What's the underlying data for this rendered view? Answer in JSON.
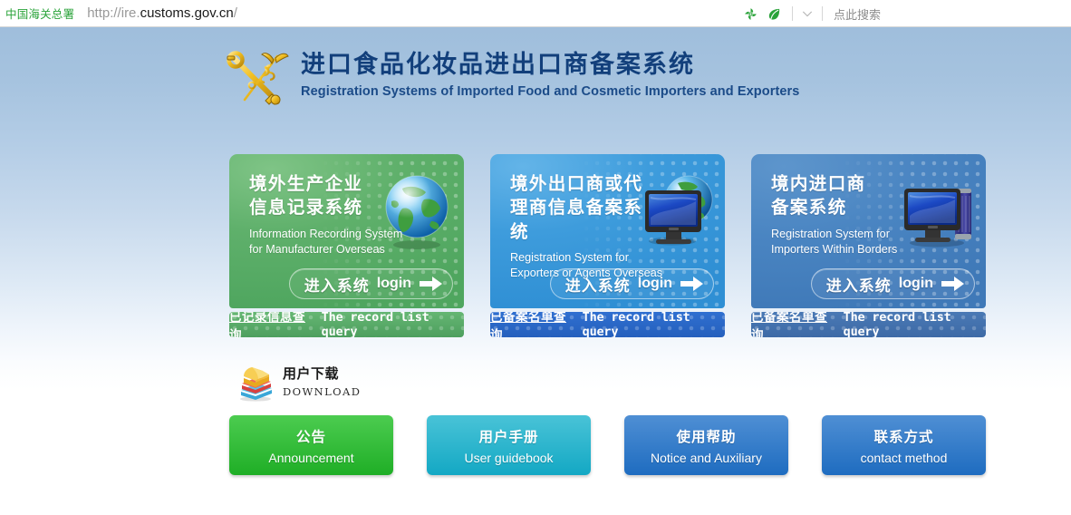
{
  "browser": {
    "site_label": "中国海关总署",
    "url": {
      "scheme": "http://",
      "subdomain": "ire.",
      "domain": "customs.gov.cn",
      "path": "/"
    },
    "icons": {
      "pinwheel": "pinwheel-icon",
      "leaf": "leaf-icon",
      "chevron": "chevron-down-icon"
    },
    "search_placeholder": "点此搜索"
  },
  "header": {
    "logo": "customs-emblem-key-caduceus",
    "title_cn": "进口食品化妆品进出口商备案系统",
    "title_en": "Registration Systems of Imported Food and Cosmetic Importers and Exporters",
    "title_color": "#123f7b"
  },
  "cards": [
    {
      "theme": "green",
      "accent": "#4fa65f",
      "title_cn_line1": "境外生产企业",
      "title_cn_line2": "信息记录系统",
      "sub_en_line1": "Information Recording System",
      "sub_en_line2": "for Manufacturer Overseas",
      "art": "globe-icon",
      "login_cn": "进入系统",
      "login_en": "login",
      "arrow": "arrow-right-icon",
      "foot_cn": "已记录信息查询",
      "foot_en": "The record list query"
    },
    {
      "theme": "blue",
      "accent": "#2f8fd4",
      "title_cn_line1": "境外出口商或代",
      "title_cn_line2": "理商信息备案系统",
      "sub_en_line1": "Registration System for",
      "sub_en_line2": "Exporters or Agents Overseas",
      "art": "monitor-globe-icon",
      "login_cn": "进入系统",
      "login_en": "login",
      "arrow": "arrow-right-icon",
      "foot_cn": "已备案名单查询",
      "foot_en": "The record list query"
    },
    {
      "theme": "steel",
      "accent": "#3f79b8",
      "title_cn_line1": "境内进口商",
      "title_cn_line2": "备案系统",
      "sub_en_line1": "Registration System for",
      "sub_en_line2": "Importers Within Borders",
      "art": "desktop-computer-icon",
      "login_cn": "进入系统",
      "login_en": "login",
      "arrow": "arrow-right-icon",
      "foot_cn": "已备案名单查询",
      "foot_en": "The record list query"
    }
  ],
  "download": {
    "icon": "stacked-books-icon",
    "label_cn": "用户下载",
    "label_en": "DOWNLOAD"
  },
  "actions": [
    {
      "key": "announce",
      "cn": "公告",
      "en": "Announcement",
      "color": "#1fae26"
    },
    {
      "key": "guidebook",
      "cn": "用户手册",
      "en": "User guidebook",
      "color": "#13a8c4"
    },
    {
      "key": "help",
      "cn": "使用帮助",
      "en": "Notice and Auxiliary",
      "color": "#1e6cc0"
    },
    {
      "key": "contact",
      "cn": "联系方式",
      "en": "contact method",
      "color": "#1e6cc0"
    }
  ]
}
